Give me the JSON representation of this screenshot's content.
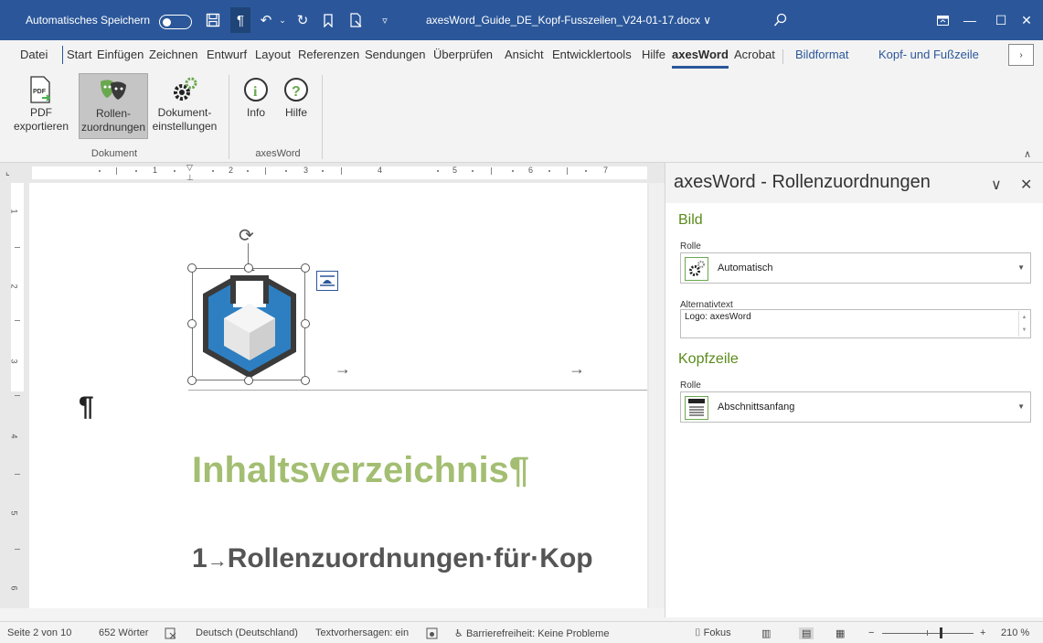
{
  "titlebar": {
    "autosave_label": "Automatisches Speichern",
    "doc_title": "axesWord_Guide_DE_Kopf-Fusszeilen_V24-01-17.docx",
    "title_caret": "∨"
  },
  "tabs": [
    "Datei",
    "Start",
    "Einfügen",
    "Zeichnen",
    "Entwurf",
    "Layout",
    "Referenzen",
    "Sendungen",
    "Überprüfen",
    "Ansicht",
    "Entwicklertools",
    "Hilfe",
    "axesWord",
    "Acrobat"
  ],
  "context_tabs": [
    "Bildformat",
    "Kopf- und Fußzeile"
  ],
  "ribbon": {
    "buttons": [
      {
        "line1": "PDF",
        "line2": "exportieren"
      },
      {
        "line1": "Rollen-",
        "line2": "zuordnungen"
      },
      {
        "line1": "Dokument-",
        "line2": "einstellungen"
      },
      {
        "line1": "Info",
        "line2": ""
      },
      {
        "line1": "Hilfe",
        "line2": ""
      }
    ],
    "groups": [
      "Dokument",
      "axesWord"
    ]
  },
  "ruler": {
    "numbers": [
      "1",
      "2",
      "3",
      "4",
      "5",
      "6",
      "7"
    ],
    "vnumbers": [
      "1",
      "2",
      "3",
      "4",
      "5",
      "6"
    ]
  },
  "document": {
    "pilcrow": "¶",
    "toc_title": "Inhaltsverzeichnis¶",
    "toc_entry_num": "1",
    "toc_entry_arrow": "→",
    "toc_entry_text": "Rollenzuordnungen·für·Kop",
    "tab_arrow": "→"
  },
  "pane": {
    "title": "axesWord - Rollenzuordnungen",
    "section_image": "Bild",
    "role_label": "Rolle",
    "image_role_value": "Automatisch",
    "alt_label": "Alternativtext",
    "alt_value": "Logo: axesWord",
    "section_header": "Kopfzeile",
    "header_role_label": "Rolle",
    "header_role_value": "Abschnittsanfang"
  },
  "status": {
    "page": "Seite 2 von 10",
    "words": "652 Wörter",
    "language": "Deutsch (Deutschland)",
    "predictions": "Textvorhersagen: ein",
    "accessibility": "Barrierefreiheit: Keine Probleme",
    "focus": "Fokus",
    "zoom": "210 %"
  },
  "colors": {
    "title_bar": "#2b579a",
    "accent_green": "#a3be72",
    "section_green": "#5a8a1a",
    "logo_blue": "#2d7fc1"
  },
  "icons": [
    "save-icon",
    "pilcrow-icon",
    "undo-icon",
    "redo-icon",
    "bookmark-icon",
    "print-preview-icon",
    "search-icon",
    "ribbon-display-icon",
    "minimize-icon",
    "maximize-icon",
    "close-icon"
  ]
}
